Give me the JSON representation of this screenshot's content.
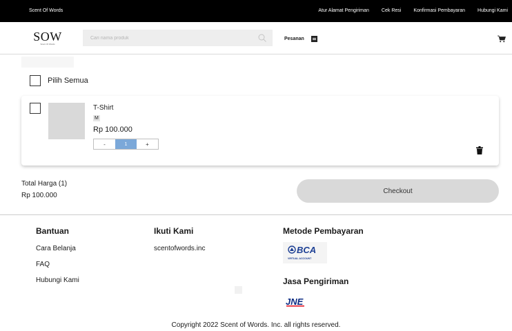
{
  "topbar": {
    "brand": "Scent Of Words",
    "links": [
      "Atur Alamat Pengiriman",
      "Cek Resi",
      "Konfirmasi Pembayaran",
      "Hubungi Kami"
    ]
  },
  "header": {
    "logo_main": "SOW",
    "logo_sub": "Scent Of Words",
    "search_placeholder": "Cari nama produk",
    "orders_label": "Pesanan"
  },
  "cart": {
    "select_all_label": "Pilih Semua",
    "items": [
      {
        "name": "T-Shirt",
        "size": "M",
        "price": "Rp 100.000",
        "quantity": "1",
        "decrement": "-",
        "increment": "+"
      }
    ],
    "total_label": "Total Harga (1)",
    "total_value": "Rp 100.000",
    "checkout_label": "Checkout"
  },
  "footer": {
    "help": {
      "title": "Bantuan",
      "links": [
        "Cara Belanja",
        "FAQ",
        "Hubungi Kami"
      ]
    },
    "follow": {
      "title": "Ikuti Kami",
      "handle": "scentofwords.inc"
    },
    "payment": {
      "title": "Metode Pembayaran",
      "logo_text": "BCA",
      "logo_sub": "VIRTUAL ACCOUNT"
    },
    "shipping": {
      "title": "Jasa Pengiriman",
      "logo_text": "JNE"
    },
    "copyright": "Copyright 2022 Scent of Words. Inc. all rights reserved."
  },
  "colors": {
    "topbar": "#000000",
    "quantity_accent": "#7ba8d9",
    "checkout_bg": "#d9d9d9",
    "bca_blue": "#1c3f94",
    "jne_red": "#e30613",
    "jne_blue": "#0b2a82"
  }
}
